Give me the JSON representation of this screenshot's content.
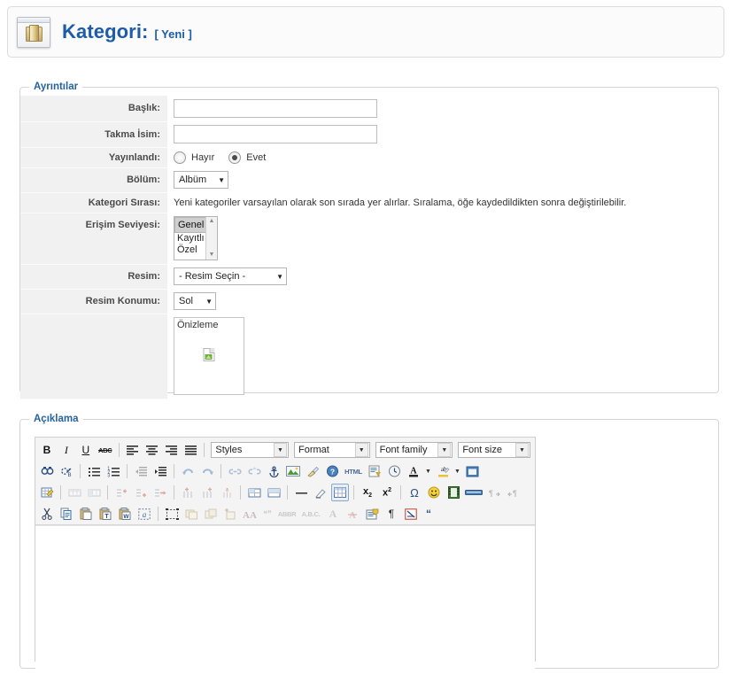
{
  "header": {
    "icon": "folder-window-icon",
    "title": "Kategori:",
    "subtitle": "[ Yeni ]"
  },
  "details": {
    "legend": "Ayrıntılar",
    "fields": {
      "baslik": {
        "label": "Başlık:",
        "value": "",
        "placeholder": ""
      },
      "takma_isim": {
        "label": "Takma İsim:",
        "value": "",
        "placeholder": ""
      },
      "yayinlandi": {
        "label": "Yayınlandı:",
        "options": [
          "Hayır",
          "Evet"
        ],
        "selected": "Evet"
      },
      "bolum": {
        "label": "Bölüm:",
        "selected": "Albüm",
        "options": [
          "Albüm"
        ]
      },
      "kategori_sirasi": {
        "label": "Kategori Sırası:",
        "hint": "Yeni kategoriler varsayılan olarak son sırada yer alırlar. Sıralama, öğe kaydedildikten sonra değiştirilebilir."
      },
      "erisim_seviyesi": {
        "label": "Erişim Seviyesi:",
        "options": [
          "Genel",
          "Kayıtlı",
          "Özel"
        ],
        "selected": "Genel"
      },
      "resim": {
        "label": "Resim:",
        "selected": "- Resim Seçin -",
        "options": [
          "- Resim Seçin -"
        ]
      },
      "resim_konumu": {
        "label": "Resim Konumu:",
        "selected": "Sol",
        "options": [
          "Sol"
        ]
      },
      "onizleme": {
        "caption": "Önizleme",
        "image": "broken-image-icon"
      }
    }
  },
  "description": {
    "legend": "Açıklama",
    "editor": {
      "dropdowns": {
        "styles": "Styles",
        "format": "Format",
        "font_family": "Font family",
        "font_size": "Font size"
      },
      "row1": [
        "bold-icon",
        "italic-icon",
        "underline-icon",
        "strikethrough-icon",
        "sep",
        "align-left-icon",
        "align-center-icon",
        "align-right-icon",
        "align-justify-icon",
        "sep"
      ],
      "row2": [
        "search-icon",
        "replace-icon",
        "sep",
        "bullet-list-icon",
        "numbered-list-icon",
        "sep",
        "outdent-icon",
        "indent-icon",
        "sep",
        "undo-icon",
        "redo-icon",
        "sep",
        "link-icon",
        "unlink-icon",
        "anchor-icon",
        "image-icon",
        "cleanup-icon",
        "help-icon",
        "html-icon",
        "toggle-editor-icon",
        "insert-date-icon",
        "text-color-icon",
        "text-color-caret",
        "background-color-icon",
        "background-color-caret",
        "fullscreen-icon"
      ],
      "row3": [
        "edit-table-icon",
        "sep",
        "row-properties-icon",
        "cell-properties-icon",
        "sep",
        "insert-row-before-icon",
        "insert-row-after-icon",
        "delete-row-icon",
        "sep",
        "insert-column-before-icon",
        "insert-column-after-icon",
        "delete-column-icon",
        "sep",
        "split-cells-icon",
        "merge-cells-icon",
        "horizontal-rule-icon",
        "remove-format-icon",
        "insert-table-icon",
        "sep",
        "subscript-icon",
        "superscript-icon",
        "sep",
        "special-character-icon",
        "emoticon-icon",
        "media-icon",
        "page-break-icon",
        "ltr-icon",
        "rtl-icon"
      ],
      "row4": [
        "cut-icon",
        "copy-icon",
        "paste-icon",
        "paste-text-icon",
        "paste-word-icon",
        "select-all-icon",
        "sep",
        "visual-aid-icon",
        "layer-icon",
        "move-forward-icon",
        "insert-layer-icon",
        "absolute-position-icon",
        "citation-icon",
        "abbreviation-icon",
        "acronym-icon",
        "insert-del-icon",
        "insert-ins-icon",
        "attributes-icon",
        "show-invisibles-icon",
        "nonbreaking-icon",
        "blockquote-icon"
      ],
      "content": ""
    }
  }
}
